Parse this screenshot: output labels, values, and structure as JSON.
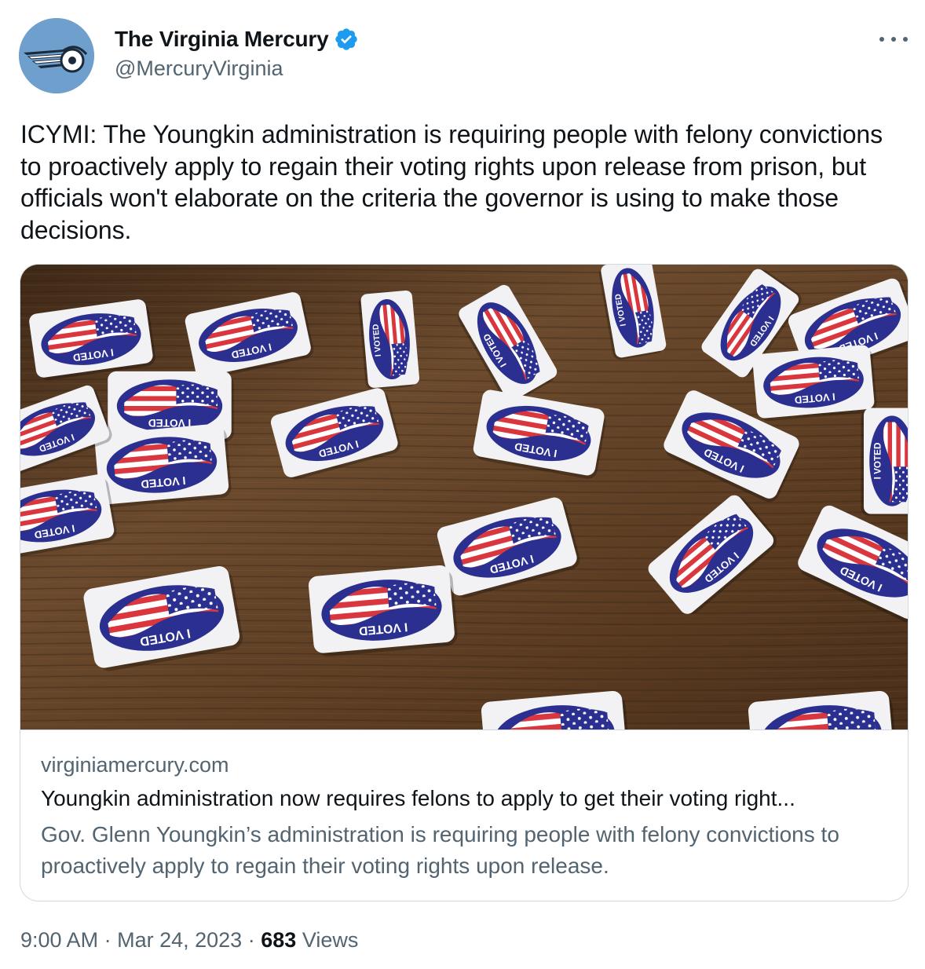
{
  "author": {
    "display_name": "The Virginia Mercury",
    "handle": "@MercuryVirginia",
    "verified": true
  },
  "tweet": {
    "text": "ICYMI: The Youngkin administration is requiring people with felony convictions to proactively apply to regain their voting rights upon release from prison, but officials won't elaborate on the criteria the governor is using to make those decisions."
  },
  "card": {
    "domain": "virginiamercury.com",
    "title": "Youngkin administration now requires felons to apply to get their voting right...",
    "description": "Gov. Glenn Youngkin’s administration is requiring people with felony convictions to proactively apply to regain their voting rights upon release.",
    "sticker_text": "I VOTED"
  },
  "meta": {
    "time": "9:00 AM",
    "separator": "·",
    "date": "Mar 24, 2023",
    "views_count": "683",
    "views_label": "Views"
  },
  "colors": {
    "verified_badge": "#1d9bf0",
    "avatar_bg": "#6f9fcd",
    "secondary_text": "#536471",
    "border": "#cfd9de",
    "sticker_blue": "#2b2f8f",
    "sticker_red": "#d9363e",
    "table_wood": "#5a3a22"
  },
  "icons": {
    "verified": "verified-badge-icon",
    "more": "more-options-icon",
    "avatar": "winged-wheel-logo"
  }
}
